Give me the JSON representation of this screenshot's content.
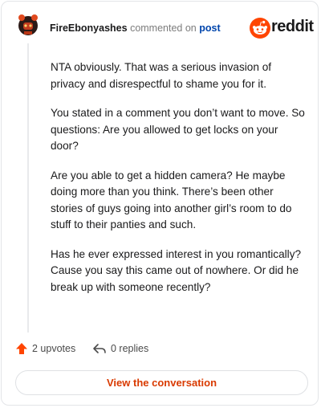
{
  "header": {
    "author": "FireEbonyashes",
    "commented_text": "commented on",
    "post_link": "post",
    "brand": "reddit"
  },
  "comment": {
    "paragraphs": [
      "NTA obviously. That was a serious invasion of privacy and disrespectful to shame you for it.",
      "You stated in a comment you don’t want to move. So questions: Are you allowed to get locks on your door?",
      "Are you able to get a hidden camera? He maybe doing more than you think. There’s been other stories of guys going into another girl’s room to do stuff to their panties and such.",
      "Has he ever expressed interest in you romantically? Cause you say this came out of nowhere. Or did he break up with someone recently?"
    ]
  },
  "actions": {
    "upvotes": "2 upvotes",
    "replies": "0 replies"
  },
  "footer": {
    "view_label": "View the conversation"
  },
  "colors": {
    "brand_orange": "#ff4500",
    "upvote_orange": "#ff4500",
    "link_blue": "#0045ac",
    "button_text": "#d93a00"
  },
  "icons": {
    "avatar": "user-avatar",
    "brand": "reddit-logo-icon",
    "upvote": "upvote-arrow-icon",
    "reply": "reply-arrow-icon"
  }
}
